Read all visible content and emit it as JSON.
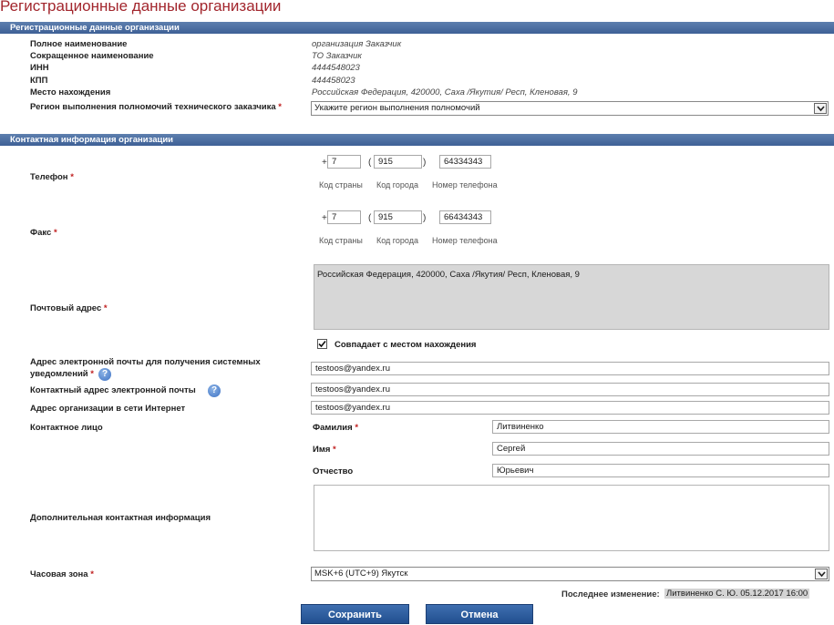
{
  "page_title": "Регистрационные данные организации",
  "registration": {
    "section_title": "Регистрационные данные организации",
    "full_name_label": "Полное наименование",
    "full_name_value": "организация Заказчик",
    "short_name_label": "Сокращенное наименование",
    "short_name_value": "ТО Заказчик",
    "inn_label": "ИНН",
    "inn_value": "4444548023",
    "kpp_label": "КПП",
    "kpp_value": "444458023",
    "location_label": "Место нахождения",
    "location_value": "Российская Федерация, 420000, Саха /Якутия/ Респ, Кленовая, 9",
    "region_label": "Регион выполнения полномочий технического заказчика",
    "region_selected": "Укажите регион выполнения полномочий"
  },
  "contact": {
    "section_title": "Контактная информация организации",
    "required_mark": "*",
    "phone": {
      "label": "Телефон",
      "plus": "+",
      "open_paren": "(",
      "close_paren": ")",
      "country_code": "7",
      "city_code": "915",
      "number": "64334343",
      "country_hint": "Код страны",
      "city_hint": "Код города",
      "number_hint": "Номер телефона"
    },
    "fax": {
      "label": "Факс",
      "plus": "+",
      "open_paren": "(",
      "close_paren": ")",
      "country_code": "7",
      "city_code": "915",
      "number": "66434343",
      "country_hint": "Код страны",
      "city_hint": "Код города",
      "number_hint": "Номер телефона"
    },
    "postal_address_label": "Почтовый адрес",
    "postal_address_value": "Российская Федерация, 420000, Саха /Якутия/ Респ, Кленовая, 9",
    "same_as_location_label": "Совпадает с местом нахождения",
    "same_as_location_checked": true,
    "notify_email_label_line1": "Адрес электронной почты для получения системных",
    "notify_email_label_line2": "уведомлений",
    "notify_email_value": "testoos@yandex.ru",
    "contact_email_label": "Контактный адрес электронной почты",
    "contact_email_value": "testoos@yandex.ru",
    "website_label": "Адрес организации в сети Интернет",
    "website_value": "testoos@yandex.ru",
    "contact_person_label": "Контактное лицо",
    "last_name_label": "Фамилия",
    "last_name_value": "Литвиненко",
    "first_name_label": "Имя",
    "first_name_value": "Сергей",
    "middle_name_label": "Отчество",
    "middle_name_value": "Юрьевич",
    "additional_info_label": "Дополнительная контактная информация",
    "additional_info_value": "",
    "timezone_label": "Часовая зона",
    "timezone_selected": "MSK+6 (UTC+9) Якутск",
    "help_glyph": "?"
  },
  "footer": {
    "last_change_label": "Последнее изменение:",
    "last_change_value": "Литвиненко С. Ю. 05.12.2017 16:00",
    "save_label": "Сохранить",
    "cancel_label": "Отмена"
  },
  "colors": {
    "title": "#a2262d",
    "section_bar": "#4a6fa5",
    "button": "#2d5c9e",
    "required": "#c02020"
  }
}
